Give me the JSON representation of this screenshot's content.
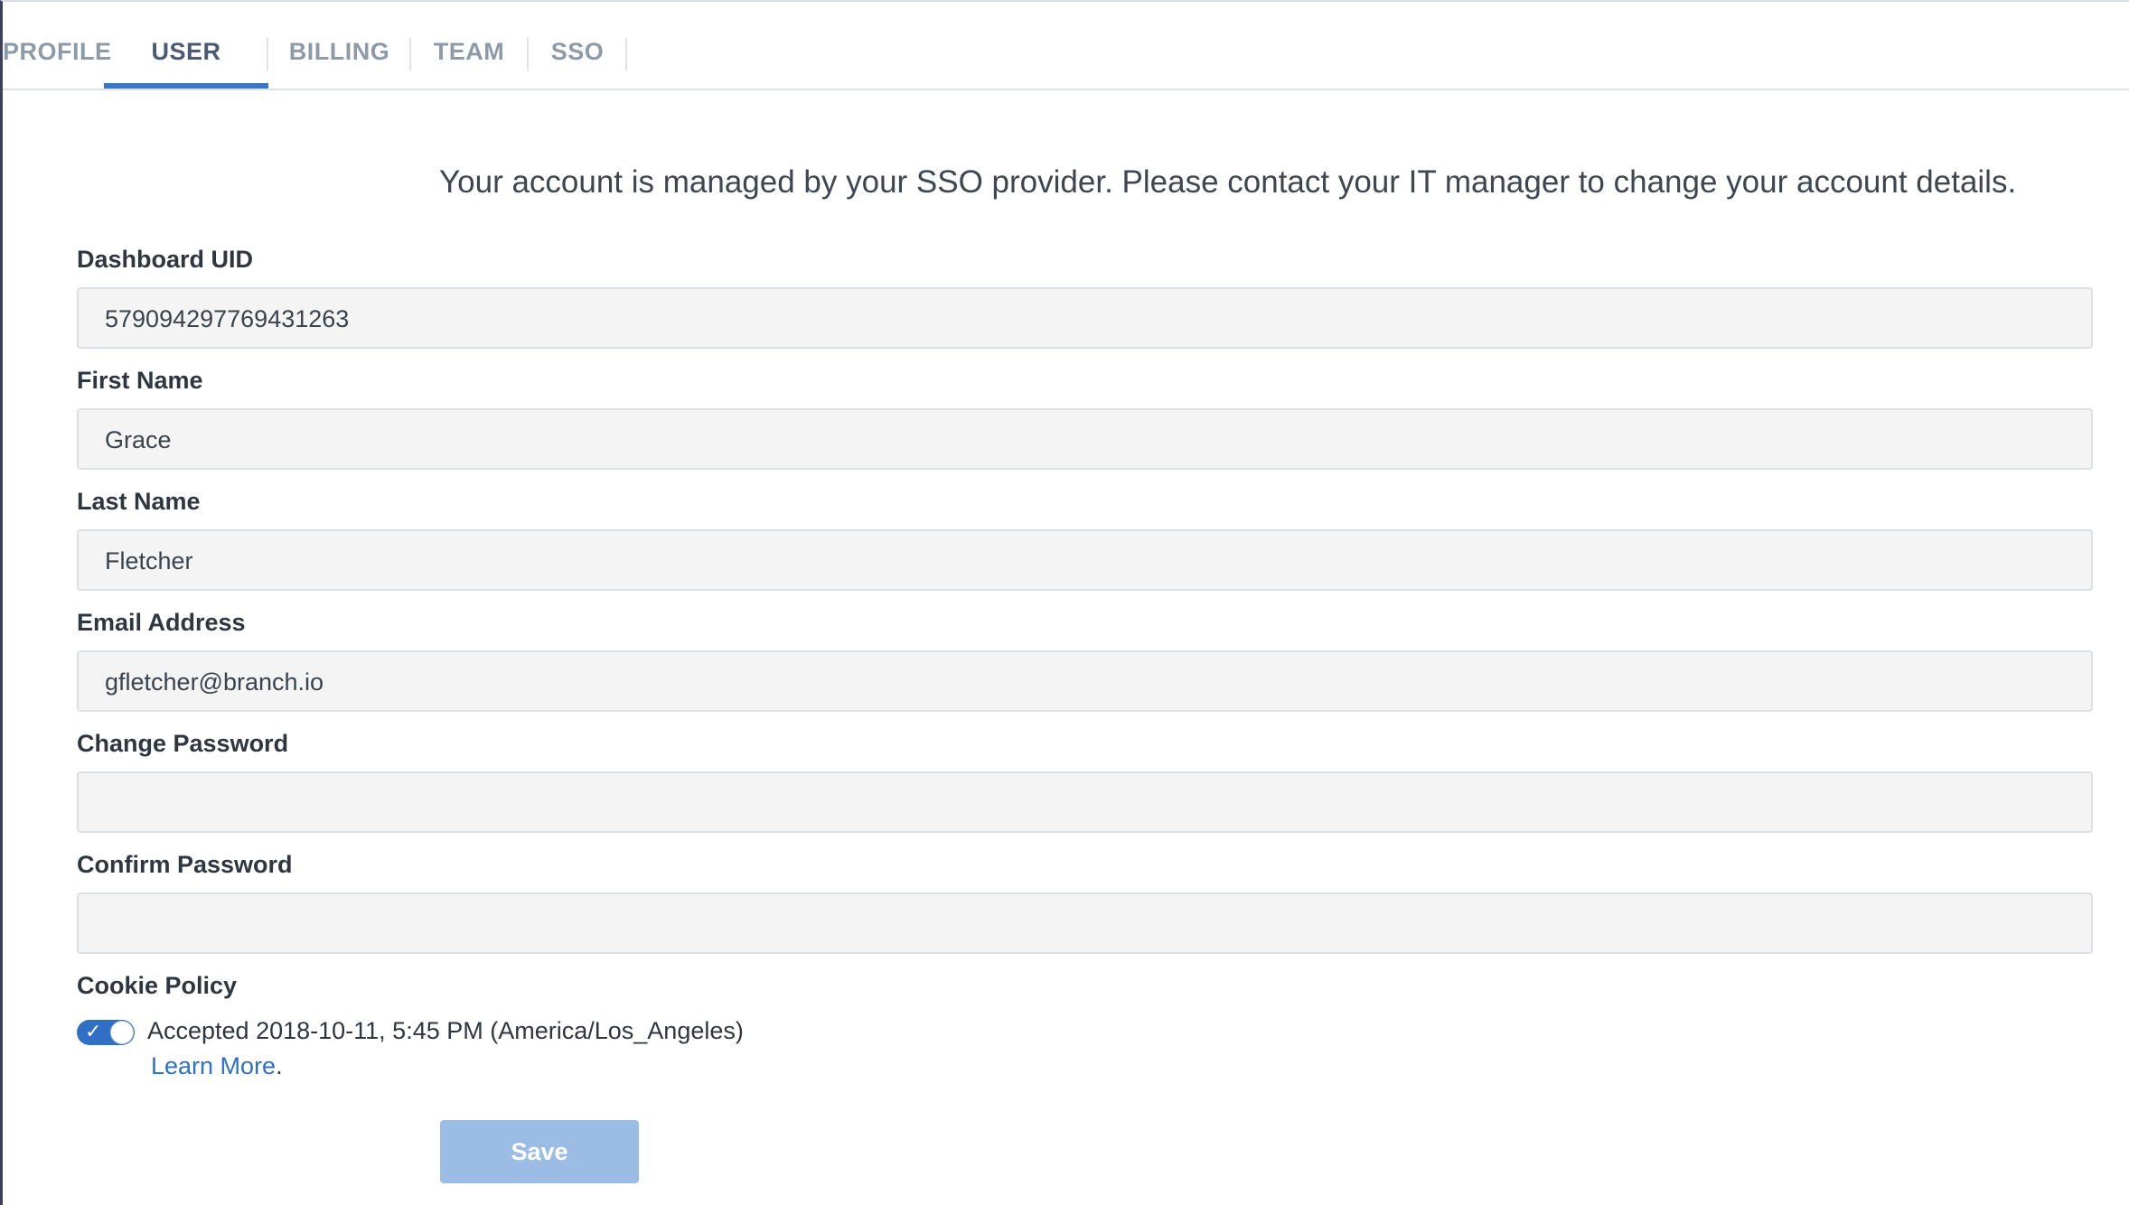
{
  "tabs": [
    {
      "label": "PROFILE"
    },
    {
      "label": "USER"
    },
    {
      "label": "BILLING"
    },
    {
      "label": "TEAM"
    },
    {
      "label": "SSO"
    }
  ],
  "active_tab": "USER",
  "notice": "Your account is managed by your SSO provider. Please contact your IT manager to change your account details.",
  "fields": {
    "uid": {
      "label": "Dashboard UID",
      "value": "579094297769431263"
    },
    "first_name": {
      "label": "First Name",
      "value": "Grace"
    },
    "last_name": {
      "label": "Last Name",
      "value": "Fletcher"
    },
    "email": {
      "label": "Email Address",
      "value": "gfletcher@branch.io"
    },
    "change_password": {
      "label": "Change Password",
      "value": ""
    },
    "confirm_password": {
      "label": "Confirm Password",
      "value": ""
    }
  },
  "cookie_policy": {
    "label": "Cookie Policy",
    "accepted_text": "Accepted 2018-10-11, 5:45 PM (America/Los_Angeles)",
    "toggle_on": true,
    "learn_more": "Learn More",
    "learn_more_suffix": "."
  },
  "save_label": "Save",
  "colors": {
    "accent": "#3b77c7",
    "save_button": "#9bbde5",
    "link": "#2f6fc6"
  }
}
